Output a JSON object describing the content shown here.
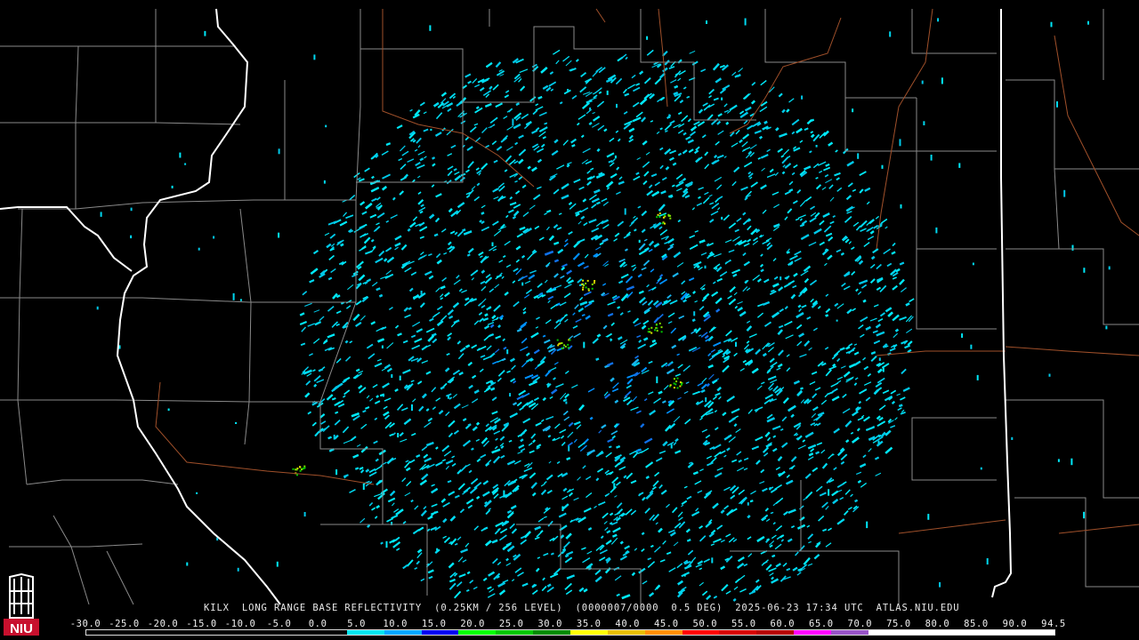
{
  "caption": {
    "station": "KILX",
    "product": "LONG RANGE BASE REFLECTIVITY",
    "resolution": "(0.25KM / 256 LEVEL)",
    "code": "(0000007/0000",
    "elevation": "0.5 DEG)",
    "datetime": "2025-06-23 17:34 UTC",
    "source": "ATLAS.NIU.EDU"
  },
  "logo": {
    "text": "NIU",
    "color": "#c8102e"
  },
  "scale": {
    "labels": [
      "-30.0",
      "-25.0",
      "-20.0",
      "-15.0",
      "-10.0",
      "-5.0",
      "0.0",
      "5.0",
      "10.0",
      "15.0",
      "20.0",
      "25.0",
      "30.0",
      "35.0",
      "40.0",
      "45.0",
      "50.0",
      "55.0",
      "60.0",
      "65.0",
      "70.0",
      "75.0",
      "80.0",
      "85.0",
      "90.0",
      "94.5"
    ],
    "colors": [
      "#000000",
      "#000000",
      "#000000",
      "#000000",
      "#000000",
      "#000000",
      "#000000",
      "#00e5ee",
      "#00a8ff",
      "#0000f0",
      "#00ff00",
      "#00c800",
      "#008c00",
      "#ffff00",
      "#e8c000",
      "#ff9000",
      "#ff0000",
      "#d80000",
      "#b80000",
      "#ff00ff",
      "#9955c8",
      "#ffffff",
      "#ffffff",
      "#ffffff",
      "#ffffff",
      "#ffffff"
    ]
  },
  "map": {
    "radar_colors": [
      "#00d8f0",
      "#00c8e8",
      "#00e8f8",
      "#18b4f0",
      "#0090ff",
      "#1070e8"
    ],
    "hot_colors": [
      "#00c800",
      "#80e000",
      "#e0e000"
    ],
    "county_line_color": "#8a8a8a",
    "state_line_color": "#ffffff",
    "highway_color": "#a0502a"
  }
}
